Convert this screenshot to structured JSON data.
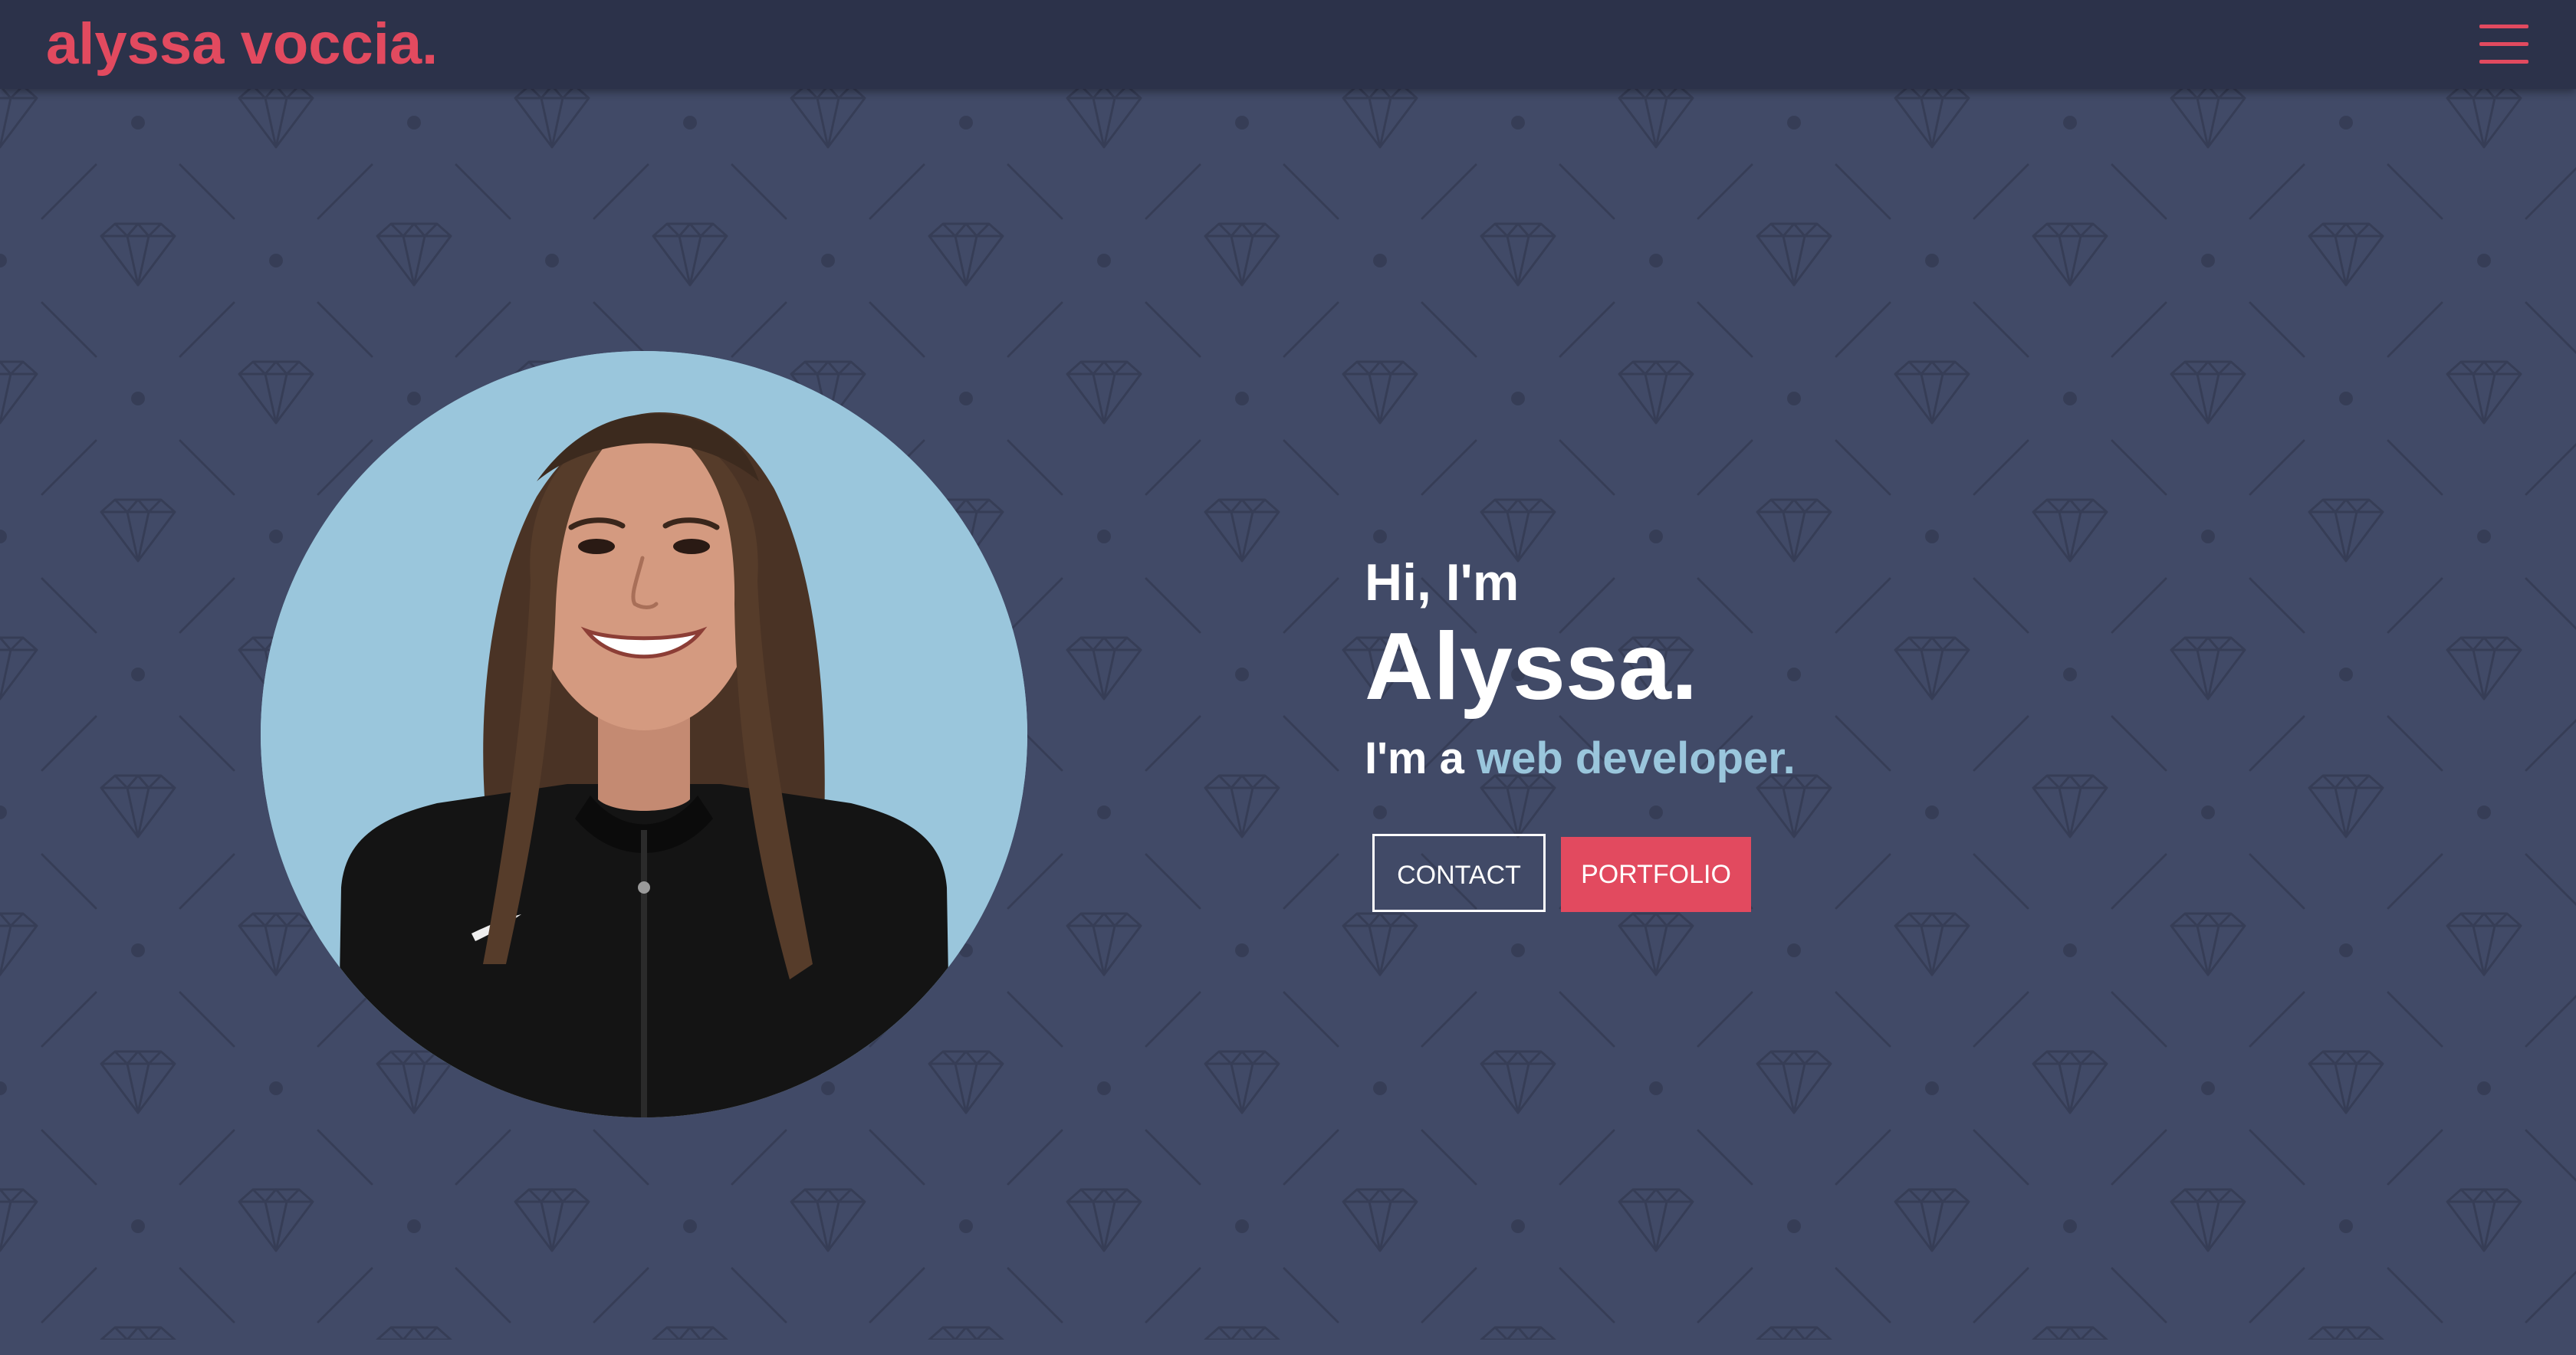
{
  "navbar": {
    "brand": "alyssa voccia.",
    "menu_icon": "hamburger-menu-icon"
  },
  "hero": {
    "greeting": "Hi, I'm",
    "name": "Alyssa.",
    "role_prefix": "I'm a ",
    "role_highlight": "web developer.",
    "contact_label": "CONTACT",
    "portfolio_label": "PORTFOLIO"
  },
  "avatar": {
    "icon": "profile-photo"
  },
  "colors": {
    "background": "#414a67",
    "navbar": "#2c324a",
    "brand_accent": "#e24a5f",
    "highlight": "#9ac6dc",
    "pattern": "#363d56"
  }
}
